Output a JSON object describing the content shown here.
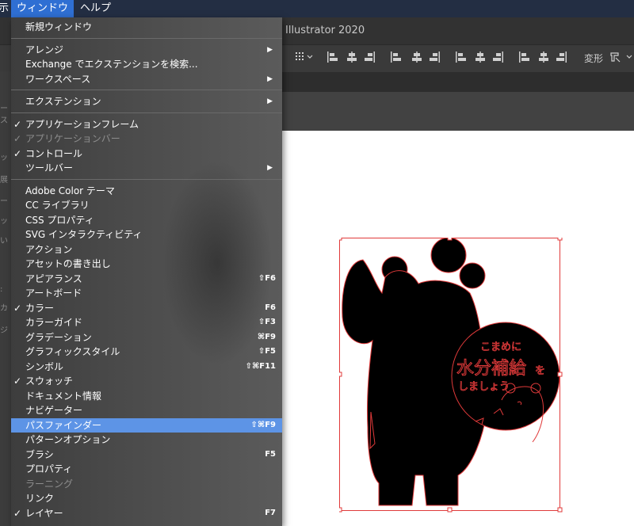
{
  "menubar": {
    "left_stub": "示",
    "window": "ウィンドウ",
    "help": "ヘルプ"
  },
  "app": {
    "title": "Illustrator 2020"
  },
  "controls": {
    "transform": "変形"
  },
  "menu": {
    "groups": [
      [
        {
          "label": "新規ウィンドウ"
        }
      ],
      [
        {
          "label": "アレンジ",
          "submenu": true
        },
        {
          "label": "Exchange でエクステンションを検索..."
        },
        {
          "label": "ワークスペース",
          "submenu": true
        }
      ],
      [
        {
          "label": "エクステンション",
          "submenu": true
        }
      ],
      [
        {
          "label": "アプリケーションフレーム",
          "checked": true
        },
        {
          "label": "アプリケーションバー",
          "checked": true,
          "disabled": true
        },
        {
          "label": "コントロール",
          "checked": true
        },
        {
          "label": "ツールバー",
          "submenu": true
        }
      ],
      [
        {
          "label": "Adobe Color テーマ"
        },
        {
          "label": "CC ライブラリ"
        },
        {
          "label": "CSS プロパティ"
        },
        {
          "label": "SVG インタラクティビティ"
        },
        {
          "label": "アクション"
        },
        {
          "label": "アセットの書き出し"
        },
        {
          "label": "アピアランス",
          "shortcut": "⇧F6"
        },
        {
          "label": "アートボード"
        },
        {
          "label": "カラー",
          "checked": true,
          "shortcut": "F6"
        },
        {
          "label": "カラーガイド",
          "shortcut": "⇧F3"
        },
        {
          "label": "グラデーション",
          "shortcut": "⌘F9"
        },
        {
          "label": "グラフィックスタイル",
          "shortcut": "⇧F5"
        },
        {
          "label": "シンボル",
          "shortcut": "⇧⌘F11"
        },
        {
          "label": "スウォッチ",
          "checked": true
        },
        {
          "label": "ドキュメント情報"
        },
        {
          "label": "ナビゲーター"
        },
        {
          "label": "パスファインダー",
          "shortcut": "⇧⌘F9",
          "highlighted": true
        },
        {
          "label": "パターンオプション"
        },
        {
          "label": "ブラシ",
          "shortcut": "F5"
        },
        {
          "label": "プロパティ"
        },
        {
          "label": "ラーニング",
          "disabled": true
        },
        {
          "label": "リンク"
        },
        {
          "label": "レイヤー",
          "checked": true,
          "shortcut": "F7"
        }
      ]
    ]
  },
  "artwork": {
    "line1": "こまめに",
    "line2": "水分補給",
    "line2_suffix": "を",
    "line3": "しましょう"
  },
  "colors": {
    "menu_highlight": "#5d94e6",
    "menubar_active": "#2f6fd3",
    "selection": "#e03a3a"
  }
}
